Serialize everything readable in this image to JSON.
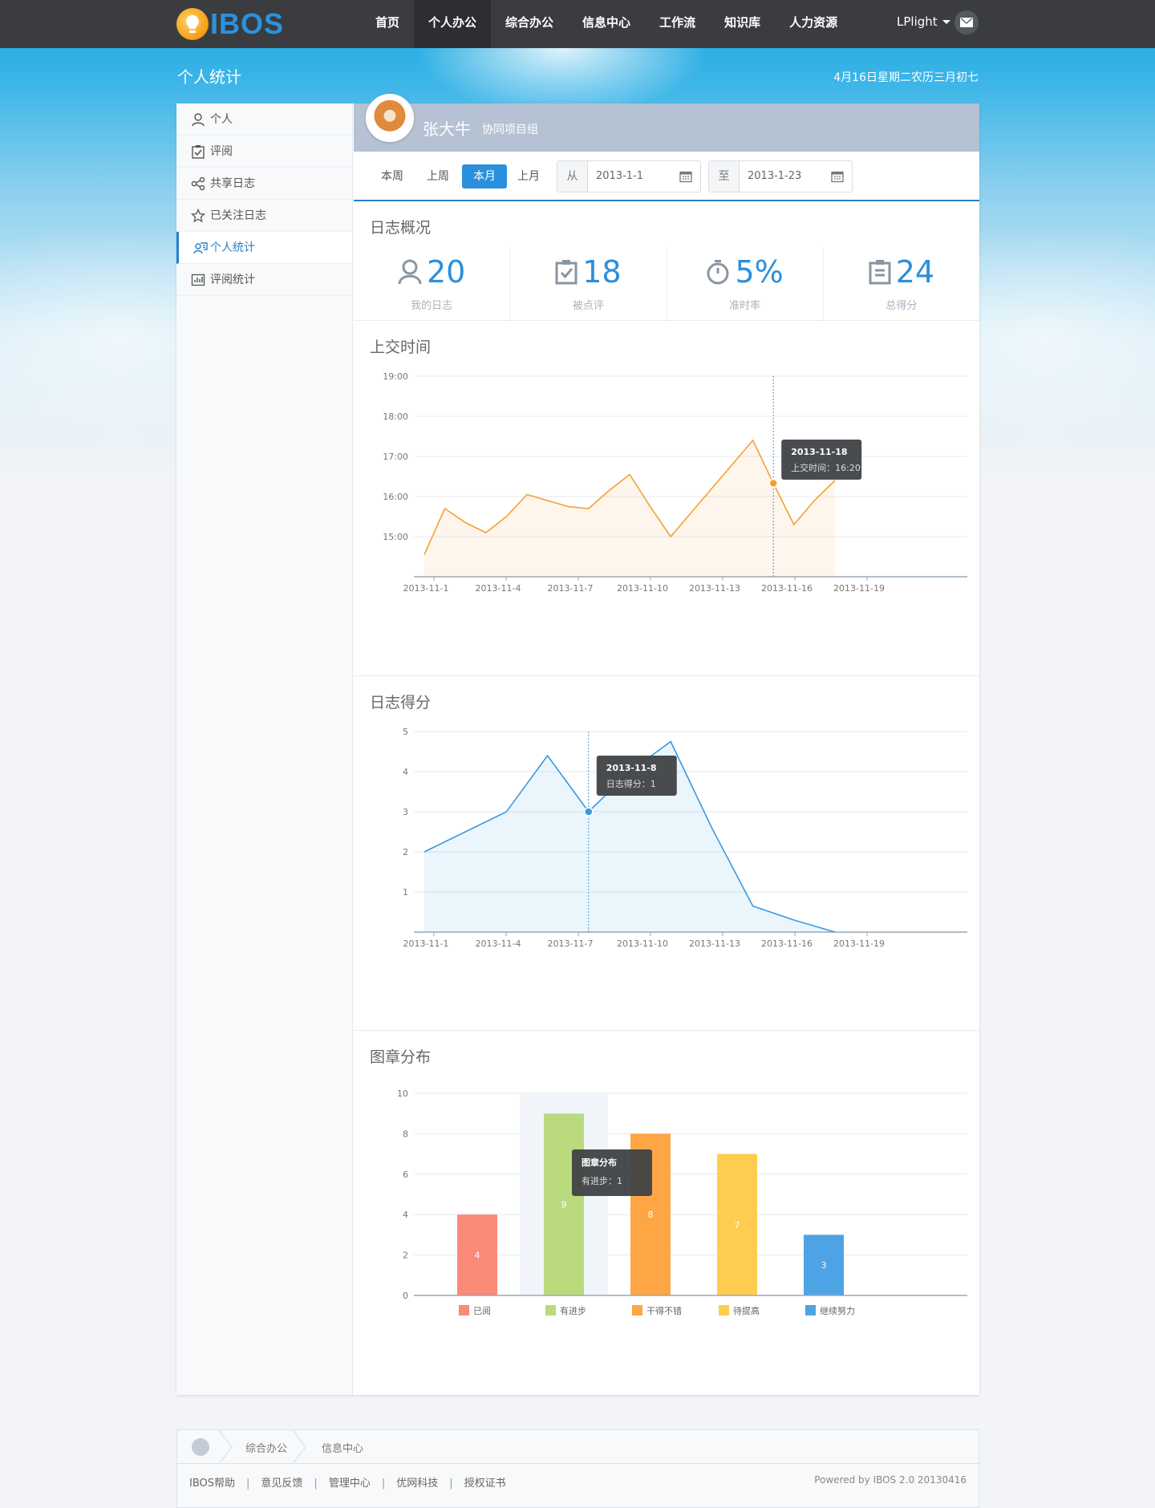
{
  "brand": {
    "logo_text": "IBOS"
  },
  "nav": {
    "items": [
      {
        "label": "首页"
      },
      {
        "label": "个人办公"
      },
      {
        "label": "综合办公"
      },
      {
        "label": "信息中心"
      },
      {
        "label": "工作流"
      },
      {
        "label": "知识库"
      },
      {
        "label": "人力资源"
      }
    ],
    "active_index": 1
  },
  "user": {
    "name": "LPlight"
  },
  "header": {
    "page_title": "个人统计",
    "date_text": "4月16日星期二农历三月初七"
  },
  "sidebar": {
    "items": [
      {
        "label": "个人",
        "icon": "user-icon"
      },
      {
        "label": "评阅",
        "icon": "check-clipboard-icon"
      },
      {
        "label": "共享日志",
        "icon": "share-icon"
      },
      {
        "label": "已关注日志",
        "icon": "star-icon"
      },
      {
        "label": "个人统计",
        "icon": "stats-user-icon"
      },
      {
        "label": "评阅统计",
        "icon": "bar-chart-icon"
      }
    ],
    "active_index": 4
  },
  "profile": {
    "name": "张大牛",
    "group": "协同项目组"
  },
  "filter": {
    "periods": [
      "本周",
      "上周",
      "本月",
      "上月"
    ],
    "active_period": "本月",
    "from_label": "从",
    "from_value": "2013-1-1",
    "to_label": "至",
    "to_value": "2013-1-23"
  },
  "overview": {
    "title": "日志概况",
    "stats": [
      {
        "value": "20",
        "label": "我的日志",
        "icon": "user-icon"
      },
      {
        "value": "18",
        "label": "被点评",
        "icon": "check-clipboard-icon"
      },
      {
        "value": "5%",
        "label": "准时率",
        "icon": "stopwatch-icon"
      },
      {
        "value": "24",
        "label": "总得分",
        "icon": "clipboard-icon"
      }
    ]
  },
  "chart_data": [
    {
      "type": "area",
      "title": "上交时间",
      "x_tick_labels": [
        "2013-11-1",
        "2013-11-4",
        "2013-11-7",
        "2013-11-10",
        "2013-11-13",
        "2013-11-16",
        "2013-11-19"
      ],
      "y_tick_labels": [
        "15:00",
        "16:00",
        "17:00",
        "18:00",
        "19:00"
      ],
      "ylim_hours": [
        14.0,
        19.0
      ],
      "series": [
        {
          "color": "#f5a033",
          "values": [
            14.55,
            15.7,
            15.35,
            15.1,
            15.5,
            16.05,
            15.9,
            15.75,
            15.7,
            16.15,
            16.55,
            15.75,
            15.0,
            15.6,
            16.2,
            16.8,
            17.4,
            16.33,
            15.3,
            15.9,
            16.4
          ]
        }
      ],
      "tooltip": {
        "date": "2013-11-18",
        "label": "上交时间",
        "value": "16:20",
        "point_index": 17
      }
    },
    {
      "type": "area",
      "title": "日志得分",
      "x_tick_labels": [
        "2013-11-1",
        "2013-11-4",
        "2013-11-7",
        "2013-11-10",
        "2013-11-13",
        "2013-11-16",
        "2013-11-19"
      ],
      "y_tick_labels": [
        "1",
        "2",
        "3",
        "4",
        "5"
      ],
      "ylim": [
        0,
        5
      ],
      "series": [
        {
          "color": "#3a9ae0",
          "values": [
            2.0,
            2.5,
            3.0,
            4.4,
            3.0,
            4.0,
            4.75,
            2.6,
            0.65,
            0.3,
            0.0
          ]
        }
      ],
      "tooltip": {
        "date": "2013-11-8",
        "label": "日志得分",
        "value": "1",
        "point_index": 4
      }
    },
    {
      "type": "bar",
      "title": "图章分布",
      "categories": [
        "已阅",
        "有进步",
        "干得不错",
        "待提高",
        "继续努力"
      ],
      "values": [
        4,
        9,
        8,
        7,
        3
      ],
      "colors": [
        "#fb8a78",
        "#b9db7d",
        "#fea644",
        "#fecd4f",
        "#4ea3e4"
      ],
      "y_tick_labels": [
        "0",
        "2",
        "4",
        "6",
        "8",
        "10"
      ],
      "ylim": [
        0,
        10
      ],
      "highlight_index": 1,
      "tooltip": {
        "title": "图章分布",
        "label": "有进步",
        "value": "1"
      }
    }
  ],
  "footer": {
    "crumbs": [
      "综合办公",
      "信息中心"
    ],
    "links": [
      "IBOS帮助",
      "意见反馈",
      "管理中心",
      "优网科技",
      "授权证书"
    ],
    "powered": "Powered by IBOS 2.0 20130416"
  }
}
